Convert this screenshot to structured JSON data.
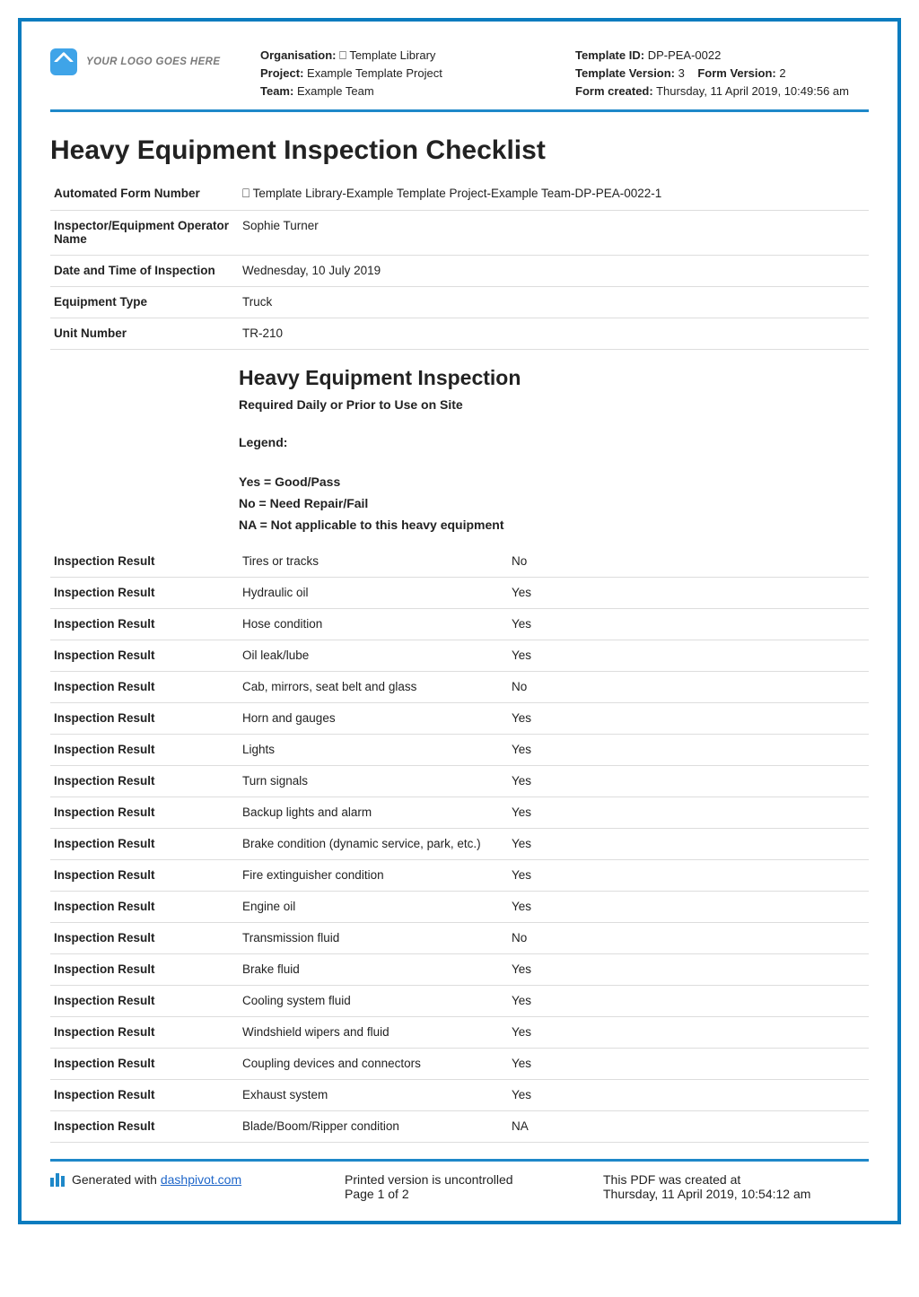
{
  "logo_placeholder": "YOUR LOGO GOES HERE",
  "header": {
    "left": {
      "org_label": "Organisation:",
      "org_value": "⎕ Template Library",
      "project_label": "Project:",
      "project_value": "Example Template Project",
      "team_label": "Team:",
      "team_value": "Example Team"
    },
    "right": {
      "tid_label": "Template ID:",
      "tid_value": "DP-PEA-0022",
      "tver_label": "Template Version:",
      "tver_value": "3",
      "fver_label": "Form Version:",
      "fver_value": "2",
      "created_label": "Form created:",
      "created_value": "Thursday, 11 April 2019, 10:49:56 am"
    }
  },
  "title": "Heavy Equipment Inspection Checklist",
  "info": [
    {
      "label": "Automated Form Number",
      "value": "⎕ Template Library-Example Template Project-Example Team-DP-PEA-0022-1"
    },
    {
      "label": "Inspector/Equipment Operator Name",
      "value": "Sophie Turner"
    },
    {
      "label": "Date and Time of Inspection",
      "value": "Wednesday, 10 July 2019"
    },
    {
      "label": "Equipment Type",
      "value": "Truck"
    },
    {
      "label": "Unit Number",
      "value": "TR-210"
    }
  ],
  "section": {
    "heading": "Heavy Equipment Inspection",
    "sub": "Required Daily or Prior to Use on Site",
    "legend_label": "Legend:",
    "legend_lines": [
      "Yes = Good/Pass",
      "No = Need Repair/Fail",
      "NA = Not applicable to this heavy equipment"
    ]
  },
  "result_label": "Inspection Result",
  "results": [
    {
      "item": "Tires or tracks",
      "value": "No"
    },
    {
      "item": "Hydraulic oil",
      "value": "Yes"
    },
    {
      "item": "Hose condition",
      "value": "Yes"
    },
    {
      "item": "Oil leak/lube",
      "value": "Yes"
    },
    {
      "item": "Cab, mirrors, seat belt and glass",
      "value": "No"
    },
    {
      "item": "Horn and gauges",
      "value": "Yes"
    },
    {
      "item": "Lights",
      "value": "Yes"
    },
    {
      "item": "Turn signals",
      "value": "Yes"
    },
    {
      "item": "Backup lights and alarm",
      "value": "Yes"
    },
    {
      "item": "Brake condition (dynamic service, park, etc.)",
      "value": "Yes"
    },
    {
      "item": "Fire extinguisher condition",
      "value": "Yes"
    },
    {
      "item": "Engine oil",
      "value": "Yes"
    },
    {
      "item": "Transmission fluid",
      "value": "No"
    },
    {
      "item": "Brake fluid",
      "value": "Yes"
    },
    {
      "item": "Cooling system fluid",
      "value": "Yes"
    },
    {
      "item": "Windshield wipers and fluid",
      "value": "Yes"
    },
    {
      "item": "Coupling devices and connectors",
      "value": "Yes"
    },
    {
      "item": "Exhaust system",
      "value": "Yes"
    },
    {
      "item": "Blade/Boom/Ripper condition",
      "value": "NA"
    }
  ],
  "footer": {
    "gen_prefix": "Generated with ",
    "gen_link": "dashpivot.com",
    "printed_line1": "Printed version is uncontrolled",
    "printed_line2": "Page 1 of 2",
    "created_line1": "This PDF was created at",
    "created_line2": "Thursday, 11 April 2019, 10:54:12 am"
  }
}
